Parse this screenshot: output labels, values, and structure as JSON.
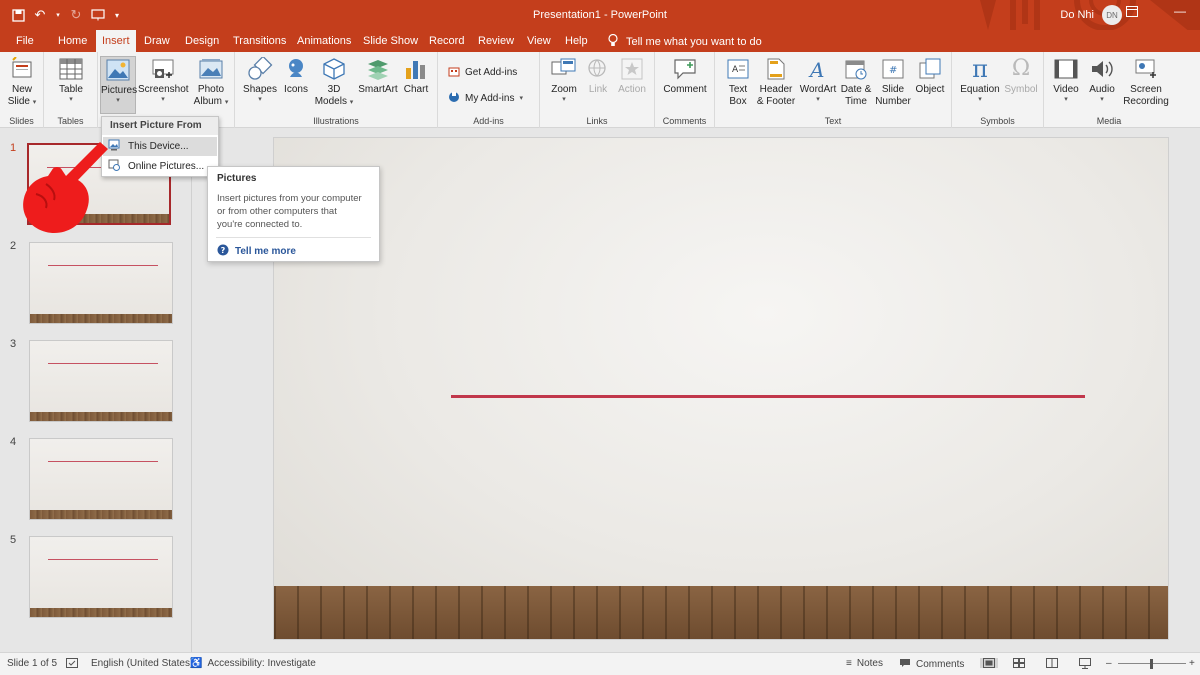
{
  "window": {
    "title": "Presentation1  -  PowerPoint",
    "user_name": "Do Nhi",
    "user_initials": "DN"
  },
  "tabs": [
    "File",
    "Home",
    "Insert",
    "Draw",
    "Design",
    "Transitions",
    "Animations",
    "Slide Show",
    "Record",
    "Review",
    "View",
    "Help"
  ],
  "active_tab": "Insert",
  "tell_me": "Tell me what you want to do",
  "ribbon": {
    "slides": {
      "label": "Slides",
      "new_slide_1": "New",
      "new_slide_2": "Slide"
    },
    "tables": {
      "label": "Tables",
      "table": "Table"
    },
    "images": {
      "pictures": "Pictures",
      "screenshot": "Screenshot",
      "photo_album_1": "Photo",
      "photo_album_2": "Album"
    },
    "illustrations": {
      "label": "Illustrations",
      "shapes": "Shapes",
      "icons": "Icons",
      "models_1": "3D",
      "models_2": "Models",
      "smartart": "SmartArt",
      "chart": "Chart"
    },
    "addins": {
      "label": "Add-ins",
      "get": "Get Add-ins",
      "my": "My Add-ins"
    },
    "links": {
      "label": "Links",
      "zoom": "Zoom",
      "link": "Link",
      "action": "Action"
    },
    "comments": {
      "label": "Comments",
      "comment": "Comment"
    },
    "text": {
      "label": "Text",
      "textbox_1": "Text",
      "textbox_2": "Box",
      "header_1": "Header",
      "header_2": "& Footer",
      "wordart": "WordArt",
      "date_1": "Date &",
      "date_2": "Time",
      "slidenum_1": "Slide",
      "slidenum_2": "Number",
      "object": "Object"
    },
    "symbols": {
      "label": "Symbols",
      "equation": "Equation",
      "symbol": "Symbol"
    },
    "media": {
      "label": "Media",
      "video": "Video",
      "audio": "Audio",
      "screen_1": "Screen",
      "screen_2": "Recording"
    }
  },
  "pictures_menu": {
    "header": "Insert Picture From",
    "items": [
      "This Device...",
      "Online Pictures..."
    ]
  },
  "tooltip": {
    "title": "Pictures",
    "body_1": "Insert pictures from your computer",
    "body_2": "or from other computers that",
    "body_3": "you're connected to.",
    "more": "Tell me more"
  },
  "slides": [
    "1",
    "2",
    "3",
    "4",
    "5"
  ],
  "selected_slide": "1",
  "status": {
    "slide_info": "Slide 1 of 5",
    "language": "English (United States)",
    "accessibility": "Accessibility: Investigate",
    "notes": "Notes",
    "comments": "Comments"
  },
  "colors": {
    "brand": "#c43e1c",
    "slide_line": "#c1374b",
    "selection": "#a7282b"
  }
}
